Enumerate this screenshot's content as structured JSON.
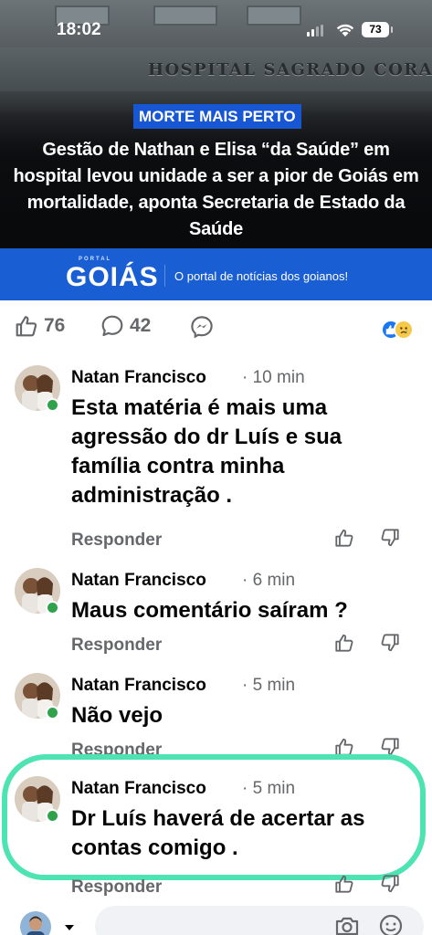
{
  "status_bar": {
    "time": "18:02",
    "battery": "73"
  },
  "post_image": {
    "sign_text": "HOSPITAL SAGRADO CORAÇ",
    "tag": "MORTE MAIS PERTO",
    "headline": "Gestão de Nathan e Elisa “da Saúde” em hospital levou unidade a ser a pior de Goiás em mortalidade, aponta Secretaria de Estado da Saúde",
    "portal_small": "PORTAL",
    "portal_logo": "GOIÁS",
    "portal_tagline": "O portal de notícias dos goianos!"
  },
  "reactions": {
    "likes": "76",
    "comments": "42"
  },
  "comments": [
    {
      "author": "Natan Francisco",
      "time": "· 10 min",
      "text": "Esta matéria é mais uma agressão  do dr Luís e sua família contra minha administração .",
      "reply_label": "Responder"
    },
    {
      "author": "Natan Francisco",
      "time": "· 6 min",
      "text": "Maus comentário saíram ?",
      "reply_label": "Responder"
    },
    {
      "author": "Natan Francisco",
      "time": "· 5 min",
      "text": "Não vejo",
      "reply_label": "Responder"
    },
    {
      "author": "Natan Francisco",
      "time": "· 5 min",
      "text": "Dr Luís haverá de acertar as contas comigo .",
      "reply_label": "Responder"
    }
  ],
  "colors": {
    "fb_blue": "#1877f2",
    "portal_blue": "#1a5ed4",
    "online_green": "#31a24c",
    "highlight": "#4ee3b2"
  }
}
